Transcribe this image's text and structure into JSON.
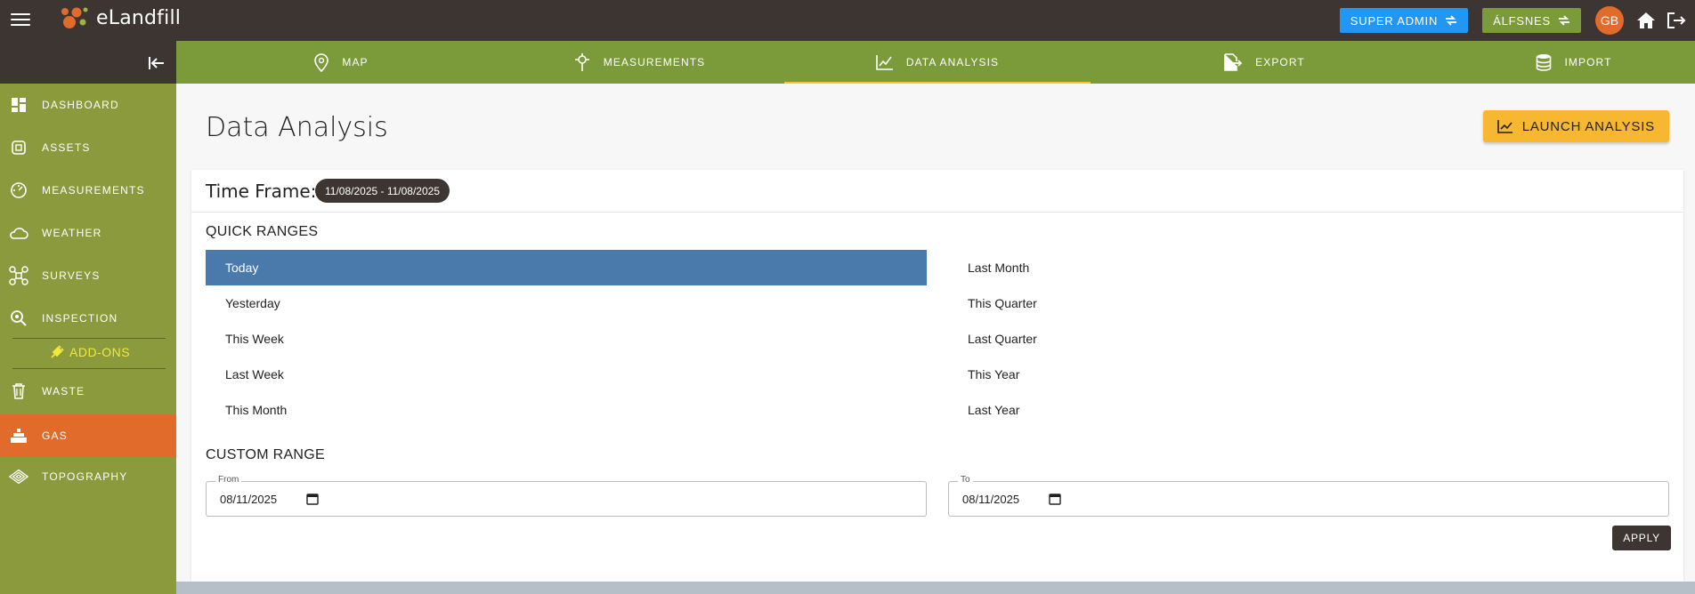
{
  "app": {
    "name": "eLandfill"
  },
  "header": {
    "admin_label": "SUPER ADMIN",
    "site_label": "ÁLFSNES",
    "avatar_initials": "GB"
  },
  "colors": {
    "topbar": "#3c3531",
    "sidebar": "#8a9a3c",
    "tabs": "#7b9a3a",
    "active_sidebar": "#e06b2a",
    "accent_yellow": "#f7b731",
    "selected_range": "#4a7aab"
  },
  "sidebar": {
    "items": [
      {
        "label": "DASHBOARD",
        "icon": "dashboard-icon"
      },
      {
        "label": "ASSETS",
        "icon": "assets-icon"
      },
      {
        "label": "MEASUREMENTS",
        "icon": "measurements-icon"
      },
      {
        "label": "WEATHER",
        "icon": "weather-icon"
      },
      {
        "label": "SURVEYS",
        "icon": "surveys-icon"
      },
      {
        "label": "INSPECTION",
        "icon": "inspection-icon"
      }
    ],
    "addons_label": "ADD-ONS",
    "addon_items": [
      {
        "label": "WASTE",
        "icon": "trash-icon"
      },
      {
        "label": "GAS",
        "icon": "gas-icon",
        "active": true
      },
      {
        "label": "TOPOGRAPHY",
        "icon": "topography-icon"
      }
    ]
  },
  "tabs": [
    {
      "label": "MAP",
      "icon": "map-pin-icon"
    },
    {
      "label": "MEASUREMENTS",
      "icon": "measurements-icon"
    },
    {
      "label": "DATA ANALYSIS",
      "icon": "chart-line-icon",
      "active": true
    },
    {
      "label": "EXPORT",
      "icon": "export-icon"
    },
    {
      "label": "IMPORT",
      "icon": "database-icon"
    }
  ],
  "main": {
    "title": "Data Analysis",
    "launch_label": "LAUNCH ANALYSIS",
    "time_frame_label": "Time Frame:",
    "time_frame_value": "11/08/2025 - 11/08/2025",
    "quick_ranges_title": "QUICK RANGES",
    "quick_ranges_left": [
      "Today",
      "Yesterday",
      "This Week",
      "Last Week",
      "This Month"
    ],
    "quick_ranges_right": [
      "Last Month",
      "This Quarter",
      "Last Quarter",
      "This Year",
      "Last Year"
    ],
    "selected_range": "Today",
    "custom_range_title": "CUSTOM RANGE",
    "from_label": "From",
    "from_value": "08/11/2025",
    "to_label": "To",
    "to_value": "08/11/2025",
    "apply_label": "APPLY"
  }
}
